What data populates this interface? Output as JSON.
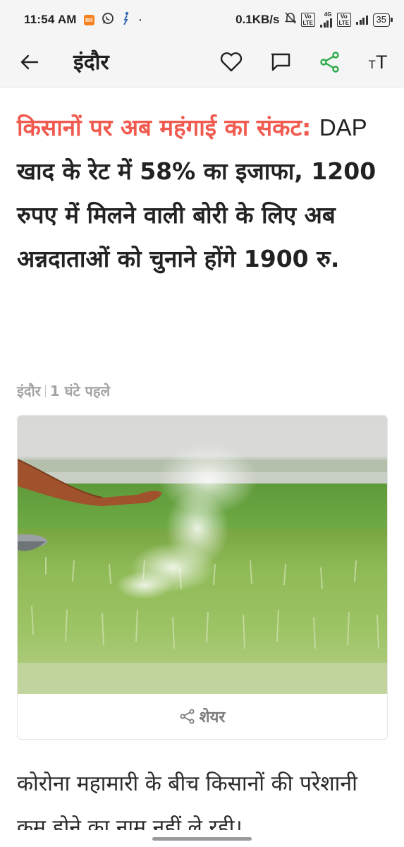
{
  "status_bar": {
    "time": "11:54 AM",
    "net_speed": "0.1KB/s",
    "battery": "35",
    "network_4g": "4G",
    "volte": "Vo LTE"
  },
  "app_bar": {
    "title": "इंदौर",
    "share_color": "#2eaa4a"
  },
  "headline": {
    "kicker": "किसानों पर अब महंगाई का संकट:",
    "latin_part": "DAP",
    "rest": "खाद के रेट में 58% का इजाफा, 1200 रुपए में मिलने वाली बोरी के लिए अब अन्नदाताओं को चुनाने होंगे 1900 रु.",
    "kicker_color": "#f05a4f"
  },
  "meta": {
    "location": "इंदौर",
    "time_ago": "1 घंटे पहले"
  },
  "image": {
    "description_icon": "photo-farmer-spreading-fertilizer"
  },
  "share": {
    "label": "शेयर"
  },
  "body": {
    "text": "कोरोना महामारी के बीच किसानों की परेशानी कम होने का नाम नहीं ले रही।"
  }
}
